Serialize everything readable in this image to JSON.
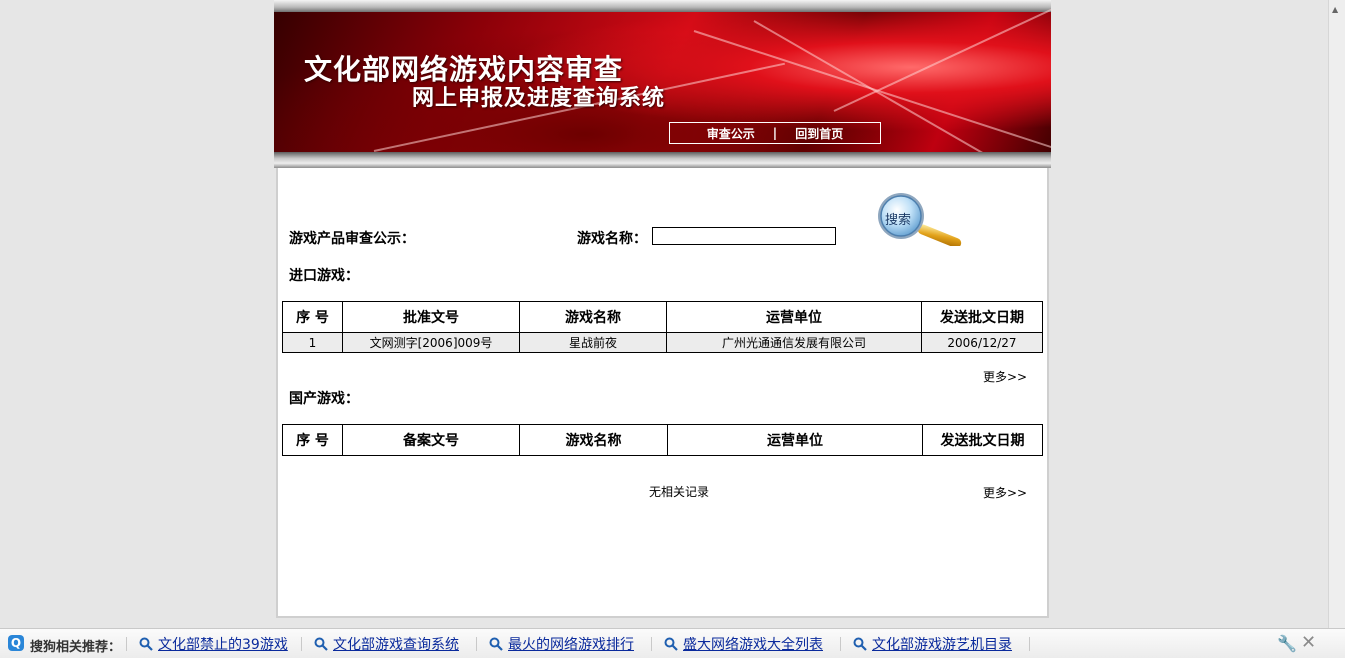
{
  "header": {
    "title_main": "文化部网络游戏内容审查",
    "title_sub": "网上申报及进度查询系统",
    "nav": {
      "review_notice": "审查公示",
      "separator": "|",
      "home": "回到首页"
    }
  },
  "search": {
    "section_label": "游戏产品审查公示：",
    "field_label": "游戏名称：",
    "input_value": "",
    "button_label": "搜索"
  },
  "imported": {
    "label": "进口游戏：",
    "columns": [
      "序 号",
      "批准文号",
      "游戏名称",
      "运营单位",
      "发送批文日期"
    ],
    "rows": [
      [
        "1",
        "文网测字[2006]009号",
        "星战前夜",
        "广州光通通信发展有限公司",
        "2006/12/27"
      ]
    ],
    "more": "更多>>"
  },
  "domestic": {
    "label": "国产游戏：",
    "columns": [
      "序 号",
      "备案文号",
      "游戏名称",
      "运营单位",
      "发送批文日期"
    ],
    "rows": [],
    "empty_text": "无相关记录",
    "more": "更多>>"
  },
  "sogou_bar": {
    "label": "搜狗相关推荐：",
    "items": [
      "文化部禁止的39游戏",
      "文化部游戏查询系统",
      "最火的网络游戏排行",
      "盛大网络游戏大全列表",
      "文化部游戏游艺机目录"
    ]
  },
  "colors": {
    "banner_red": "#d30b16",
    "link_blue": "#0a2a9c",
    "page_bg": "#e6e6e6"
  }
}
